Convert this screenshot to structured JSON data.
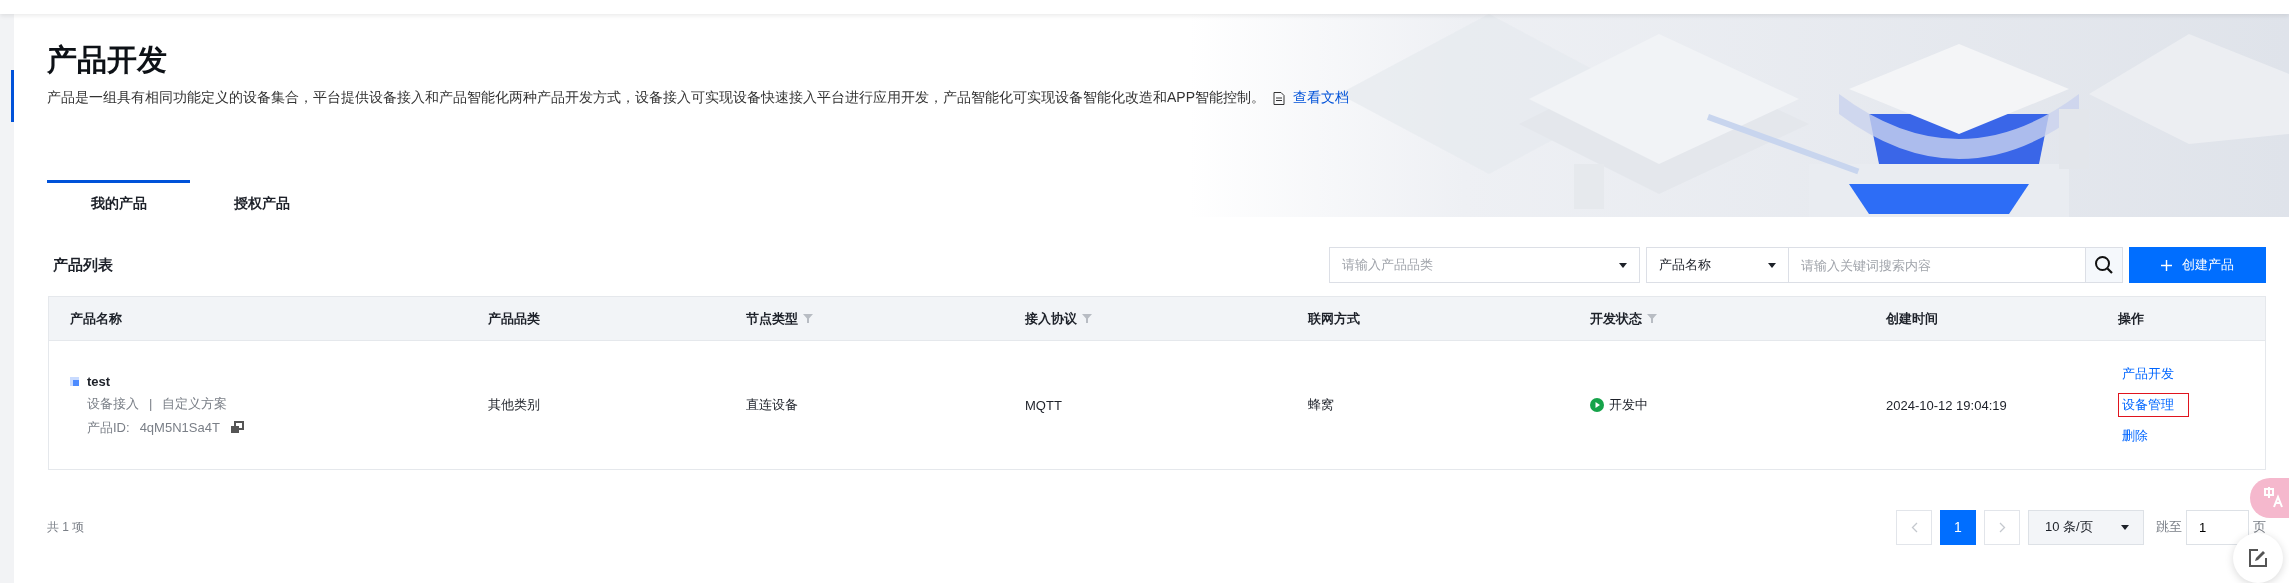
{
  "page": {
    "title": "产品开发",
    "description": "产品是一组具有相同功能定义的设备集合，平台提供设备接入和产品智能化两种产品开发方式，设备接入可实现设备快速接入平台进行应用开发，产品智能化可实现设备智能化改造和APP智能控制。",
    "doc_link": "查看文档"
  },
  "tabs": [
    {
      "label": "我的产品",
      "selected": true
    },
    {
      "label": "授权产品",
      "selected": false
    }
  ],
  "list": {
    "title": "产品列表",
    "category_select": {
      "placeholder": "请输入产品品类"
    },
    "field_select": {
      "value": "产品名称"
    },
    "search": {
      "placeholder": "请输入关键词搜索内容"
    },
    "create_button": "创建产品"
  },
  "table": {
    "columns": [
      {
        "label": "产品名称",
        "filter": false
      },
      {
        "label": "产品品类",
        "filter": false
      },
      {
        "label": "节点类型",
        "filter": true
      },
      {
        "label": "接入协议",
        "filter": true
      },
      {
        "label": "联网方式",
        "filter": false
      },
      {
        "label": "开发状态",
        "filter": true
      },
      {
        "label": "创建时间",
        "filter": false
      },
      {
        "label": "操作",
        "filter": false
      }
    ],
    "rows": [
      {
        "name": "test",
        "access": "设备接入",
        "separator": "|",
        "scheme": "自定义方案",
        "id_label": "产品ID:",
        "id": "4qM5N1Sa4T",
        "category": "其他类别",
        "node_type": "直连设备",
        "protocol": "MQTT",
        "network": "蜂窝",
        "status": "开发中",
        "created": "2024-10-12 19:04:19",
        "actions": [
          {
            "label": "产品开发",
            "highlighted": false
          },
          {
            "label": "设备管理",
            "highlighted": true
          },
          {
            "label": "删除",
            "highlighted": false
          }
        ]
      }
    ]
  },
  "pagination": {
    "total": "共 1 项",
    "pages": [
      {
        "label": "1",
        "selected": true
      }
    ],
    "page_size": "10 条/页",
    "jump_label": "跳至",
    "jump_value": "1",
    "page_unit": "页"
  }
}
